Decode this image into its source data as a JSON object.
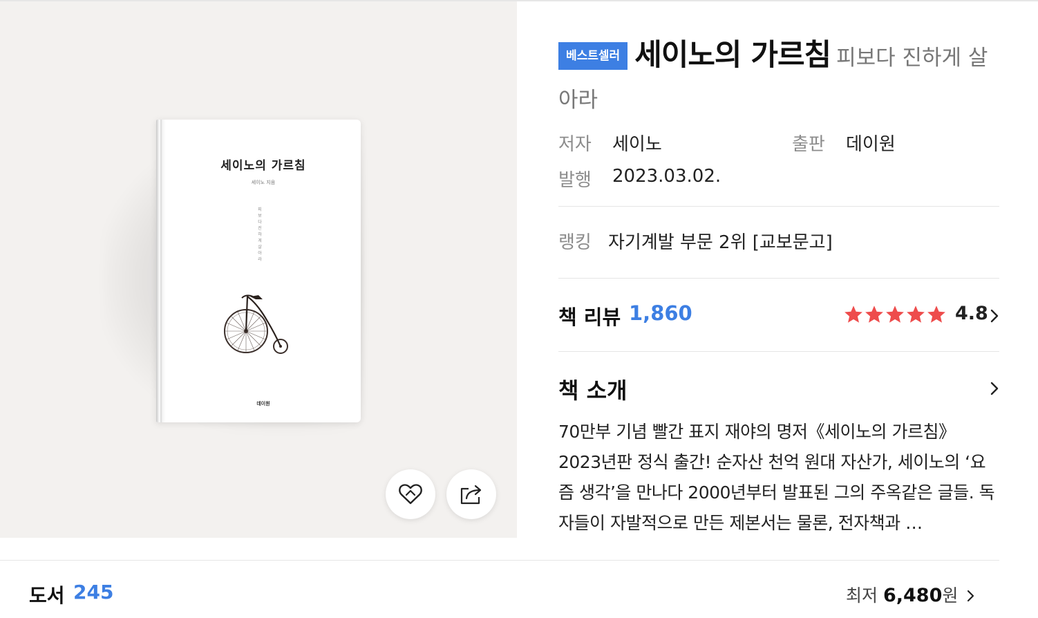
{
  "badge": "베스트셀러",
  "title": {
    "main": "세이노의 가르침",
    "subtitle": "피보다 진하게 살아라"
  },
  "meta": {
    "author_label": "저자",
    "author": "세이노",
    "publisher_label": "출판",
    "publisher": "데이원",
    "date_label": "발행",
    "date": "2023.03.02."
  },
  "ranking": {
    "label": "랭킹",
    "value": "자기계발 부문 2위 [교보문고]"
  },
  "review": {
    "label": "책 리뷰",
    "count": "1,860",
    "rating": "4.8",
    "stars": 5,
    "star_color": "#ee4c4c"
  },
  "intro": {
    "label": "책 소개",
    "text": "70만부 기념 빨간 표지 재야의 명저《세이노의 가르침》2023년판 정식 출간! 순자산 천억 원대 자산가, 세이노의 ‘요즘 생각’을 만나다 2000년부터 발표된 그의 주옥같은 글들. 독자들이 자발적으로 만든 제본서는 물론, 전자책과 …"
  },
  "cover": {
    "title": "세이노의 가르침",
    "author": "세이노 지음",
    "vertical_text": "피보다 진하게 살아라",
    "publisher": "데이원"
  },
  "actions": {
    "like_icon": "heart-icon",
    "share_icon": "share-icon"
  },
  "bottom": {
    "books_label": "도서",
    "books_count": "245",
    "price_prefix": "최저",
    "price": "6,480",
    "price_unit": "원"
  },
  "colors": {
    "accent": "#3d7fe3",
    "star": "#ee4c4c",
    "panel_bg": "#f3f1ef"
  }
}
